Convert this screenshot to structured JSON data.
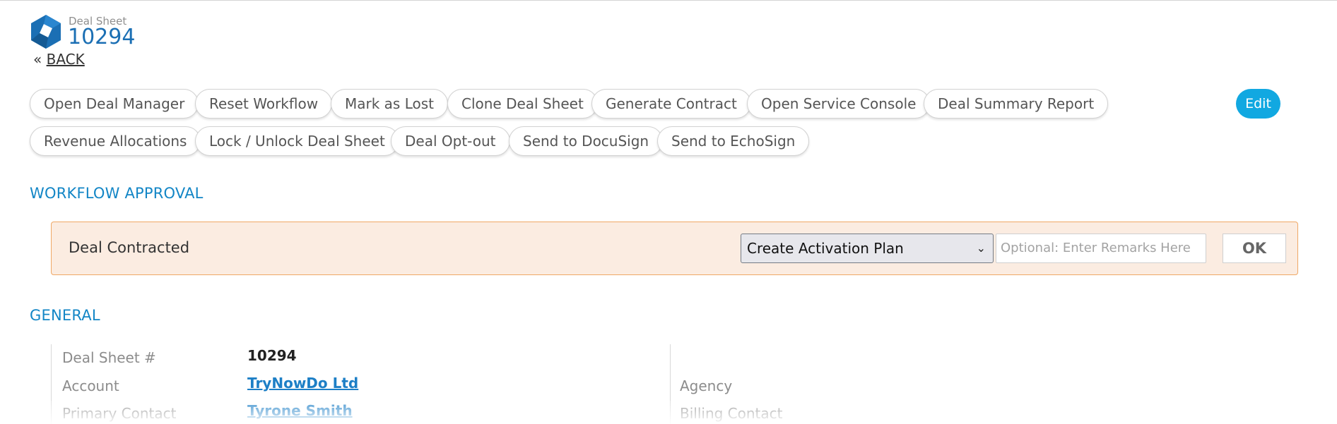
{
  "header": {
    "subtitle": "Deal Sheet",
    "number": "10294",
    "back_prefix": "«",
    "back_label": "BACK"
  },
  "actions": {
    "row1": [
      "Open Deal Manager",
      "Reset Workflow",
      "Mark as Lost",
      "Clone Deal Sheet",
      "Generate Contract",
      "Open Service Console",
      "Deal Summary Report"
    ],
    "row2": [
      "Revenue Allocations",
      "Lock / Unlock Deal Sheet",
      "Deal Opt-out",
      "Send to DocuSign",
      "Send to EchoSign"
    ],
    "edit_label": "Edit"
  },
  "workflow": {
    "title": "WORKFLOW APPROVAL",
    "status": "Deal Contracted",
    "selected_action": "Create Activation Plan",
    "remarks_placeholder": "Optional: Enter Remarks Here",
    "ok_label": "OK"
  },
  "general": {
    "title": "GENERAL",
    "left": [
      {
        "label": "Deal Sheet #",
        "value": "10294"
      },
      {
        "label": "Account",
        "value": "TryNowDo Ltd"
      },
      {
        "label": "Primary Contact",
        "value": "Tyrone Smith"
      }
    ],
    "right": [
      {
        "label": "Agency"
      },
      {
        "label": "Billing Contact"
      }
    ]
  },
  "colors": {
    "accent": "#11a8e1",
    "section_title": "#1386c6",
    "workflow_bg": "#fbece1",
    "workflow_border": "#f0a865"
  }
}
